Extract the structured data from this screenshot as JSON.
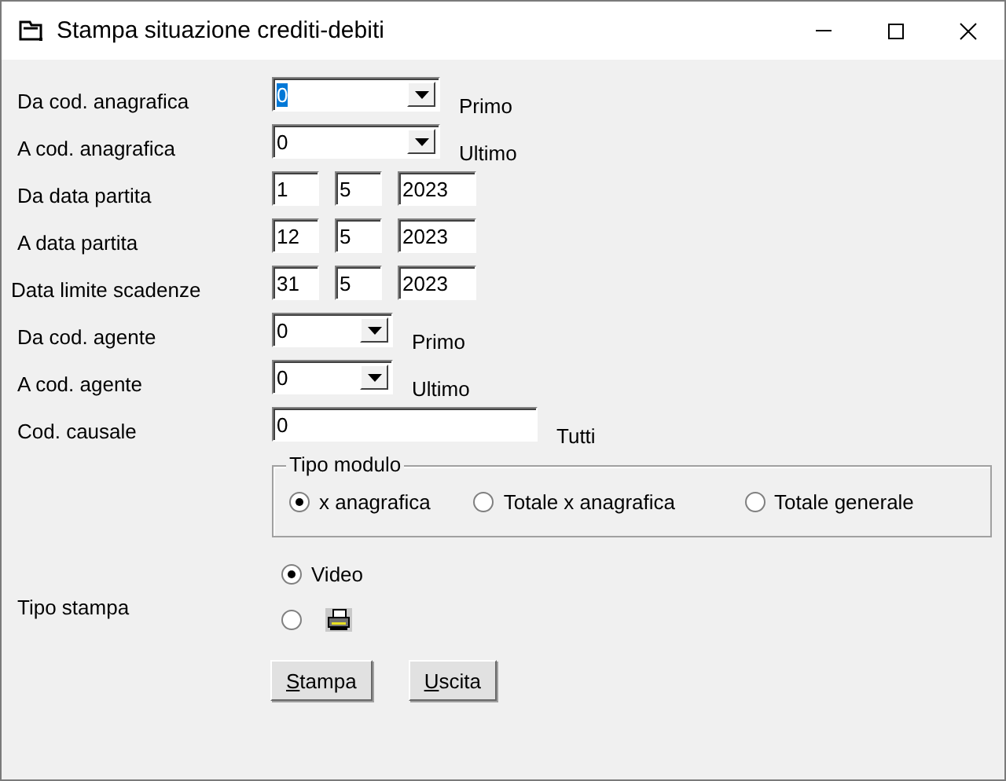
{
  "window": {
    "title": "Stampa situazione crediti-debiti"
  },
  "fields": [
    {
      "kind": "combo",
      "label": "Da cod. anagrafica",
      "values": [
        "0"
      ],
      "suffix": "Primo",
      "focused": true
    },
    {
      "kind": "combo",
      "label": "A cod. anagrafica",
      "values": [
        "0"
      ],
      "suffix": "Ultimo",
      "focused": false
    },
    {
      "kind": "date",
      "label": "Da data partita",
      "values": [
        "1",
        "5",
        "2023"
      ],
      "focused": false
    },
    {
      "kind": "date",
      "label": "A data partita",
      "values": [
        "12",
        "5",
        "2023"
      ],
      "focused": false
    },
    {
      "kind": "date",
      "label": "Data limite scadenze",
      "values": [
        "31",
        "5",
        "2023"
      ],
      "focused": false
    },
    {
      "kind": "smallcombo",
      "label": "Da cod. agente",
      "values": [
        "0"
      ],
      "suffix": "Primo",
      "focused": false
    },
    {
      "kind": "smallcombo",
      "label": "A cod. agente",
      "values": [
        "0"
      ],
      "suffix": "Ultimo",
      "focused": false
    },
    {
      "kind": "text",
      "label": "Cod. causale",
      "values": [
        "0"
      ],
      "suffix": "Tutti",
      "focused": false
    }
  ],
  "tipo_modulo": {
    "title": "Tipo modulo",
    "options": [
      {
        "label": "x anagrafica",
        "selected": true
      },
      {
        "label": "Totale x anagrafica",
        "selected": false
      },
      {
        "label": "Totale generale",
        "selected": false
      }
    ]
  },
  "tipo_stampa": {
    "label": "Tipo stampa",
    "options": [
      {
        "kind": "text",
        "label": "Video",
        "selected": true
      },
      {
        "kind": "printer",
        "selected": false
      }
    ]
  },
  "buttons": [
    {
      "access_key": "S",
      "label_rest": "tampa"
    },
    {
      "access_key": "U",
      "label_rest": "scita"
    }
  ]
}
